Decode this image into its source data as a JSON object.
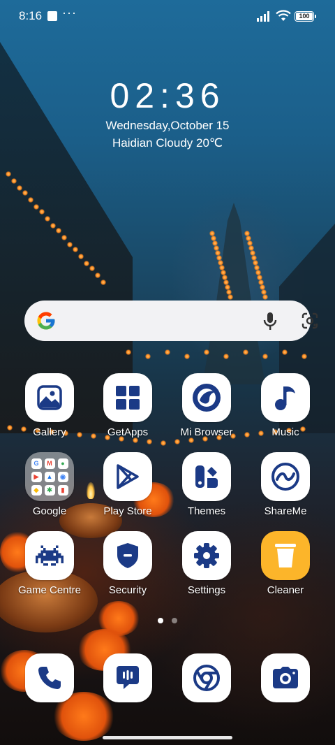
{
  "status_bar": {
    "time": "8:16",
    "more": "···",
    "battery": "100"
  },
  "clock": {
    "time": "02:36",
    "date": "Wednesday,October 15",
    "weather": "Haidian Cloudy 20℃"
  },
  "search": {
    "icons": [
      "google-logo",
      "microphone-icon",
      "google-lens-icon"
    ]
  },
  "apps": [
    {
      "label": "Gallery",
      "icon": "gallery-icon"
    },
    {
      "label": "GetApps",
      "icon": "getapps-icon"
    },
    {
      "label": "Mi Browser",
      "icon": "mi-browser-icon"
    },
    {
      "label": "Music",
      "icon": "music-icon"
    },
    {
      "label": "Google",
      "icon": "google-folder-icon"
    },
    {
      "label": "Play Store",
      "icon": "play-store-icon"
    },
    {
      "label": "Themes",
      "icon": "themes-icon"
    },
    {
      "label": "ShareMe",
      "icon": "shareme-icon"
    },
    {
      "label": "Game Centre",
      "icon": "game-centre-icon"
    },
    {
      "label": "Security",
      "icon": "security-icon"
    },
    {
      "label": "Settings",
      "icon": "settings-icon"
    },
    {
      "label": "Cleaner",
      "icon": "cleaner-icon"
    }
  ],
  "page_indicator": {
    "pages": 2,
    "current": 1
  },
  "dock": [
    {
      "icon": "phone-icon"
    },
    {
      "icon": "messages-icon"
    },
    {
      "icon": "chrome-icon"
    },
    {
      "icon": "camera-icon"
    }
  ],
  "colors": {
    "icon_blue": "#1b3a86",
    "cleaner_yellow": "#fcb52a"
  }
}
